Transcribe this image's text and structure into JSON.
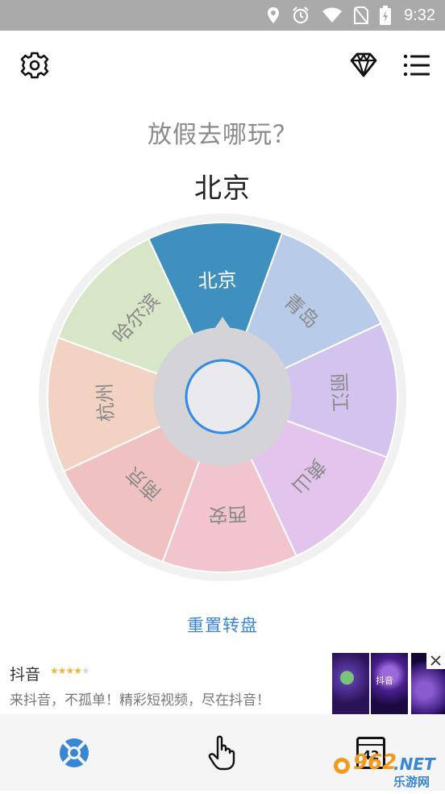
{
  "status_bar": {
    "time": "9:32",
    "icons": [
      "location-icon",
      "alarm-icon",
      "wifi-icon",
      "no-sim-icon",
      "battery-charging-icon"
    ]
  },
  "top_bar": {
    "left_icon": "settings-gear-icon",
    "right_icons": [
      "diamond-icon",
      "list-menu-icon"
    ]
  },
  "question": "放假去哪玩？",
  "result": "北京",
  "wheel": {
    "segments": [
      {
        "label": "北京",
        "color": "#3f8fbf",
        "text_color": "#ffffff"
      },
      {
        "label": "青岛",
        "color": "#b8cbe9",
        "text_color": "#8a8a8a"
      },
      {
        "label": "丽江",
        "color": "#d3c3ef",
        "text_color": "#8a8a8a"
      },
      {
        "label": "黄山",
        "color": "#e3c4ec",
        "text_color": "#8a8a8a"
      },
      {
        "label": "西安",
        "color": "#f2c4ce",
        "text_color": "#8a8a8a"
      },
      {
        "label": "南京",
        "color": "#efc1c1",
        "text_color": "#8a8a8a"
      },
      {
        "label": "杭州",
        "color": "#f2d3c3",
        "text_color": "#8a8a8a"
      },
      {
        "label": "哈尔滨",
        "color": "#d6e6c6",
        "text_color": "#8a8a8a"
      }
    ],
    "hub_color": "#d4d4d8",
    "button_ring_color": "#2f8be6"
  },
  "reset_label": "重置转盘",
  "ad": {
    "app_name": "抖音",
    "stars": "★★★★★",
    "description": "来抖音，不孤单！精彩短视频，尽在抖音！",
    "thumb_text": "抖音"
  },
  "bottom_nav": {
    "icons": [
      "lifebuoy-icon",
      "tap-hand-icon",
      "counter-box-icon"
    ],
    "counter": "42"
  },
  "watermark": {
    "brand": "962",
    "suffix": ".NET",
    "sub": "乐游网"
  },
  "accent_color": "#3a86d6"
}
